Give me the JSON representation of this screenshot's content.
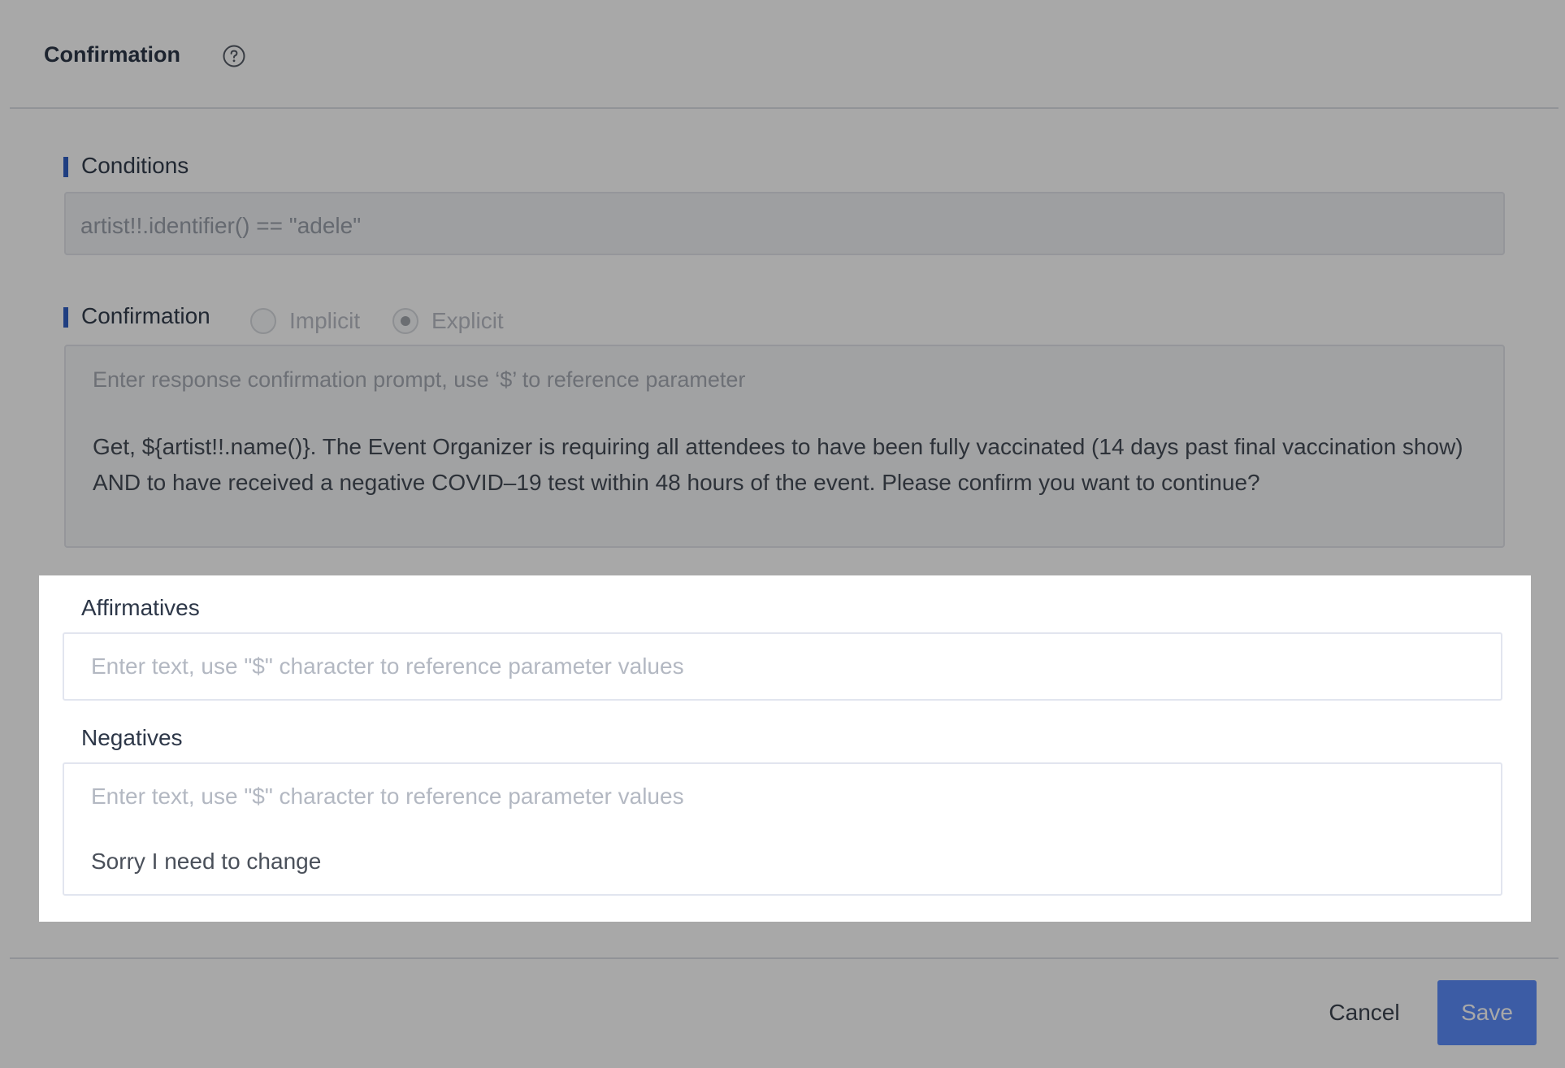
{
  "header": {
    "title": "Confirmation",
    "help_icon": "question-circle-icon"
  },
  "conditions": {
    "label": "Conditions",
    "value": "artist!!.identifier() == \"adele\""
  },
  "confirmation": {
    "label": "Confirmation",
    "options": [
      {
        "label": "Implicit",
        "selected": false
      },
      {
        "label": "Explicit",
        "selected": true
      }
    ],
    "prompt_placeholder": "Enter response confirmation prompt, use ‘$’ to reference parameter",
    "prompt_text": "Get, ${artist!!.name()}. The Event Organizer is requiring all attendees to have been fully vaccinated (14 days past final vaccination show) AND to have received a negative COVID–19 test within 48 hours of the event. Please confirm you want to continue?"
  },
  "affirmatives": {
    "label": "Affirmatives",
    "placeholder": "Enter text, use \"$\" character to reference parameter values"
  },
  "negatives": {
    "label": "Negatives",
    "placeholder": "Enter text, use \"$\" character to reference parameter values",
    "items": [
      "Sorry I need to change"
    ]
  },
  "footer": {
    "cancel_label": "Cancel",
    "save_label": "Save"
  },
  "colors": {
    "accent": "#2f5ec4",
    "save_button": "#5b8cfa",
    "overlay": "rgba(0,0,0,0.34)"
  }
}
